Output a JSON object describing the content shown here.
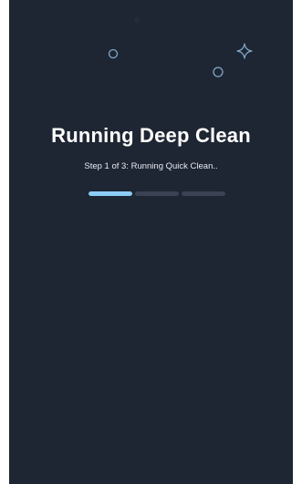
{
  "header": {
    "title": "Running Deep Clean",
    "status": "Step 1 of 3: Running Quick Clean.."
  },
  "progress": {
    "steps_total": 3,
    "current_step": 1,
    "segments": [
      {
        "fill_fraction": 1.0
      },
      {
        "fill_fraction": 0.0
      },
      {
        "fill_fraction": 0.0
      }
    ]
  },
  "decorations": [
    "circle-icon",
    "circle-icon",
    "sparkle-icon"
  ],
  "colors": {
    "background": "#1e2533",
    "accent": "#8ccdf5",
    "track": "#3a4254",
    "decoration": "#7fa9c9"
  }
}
